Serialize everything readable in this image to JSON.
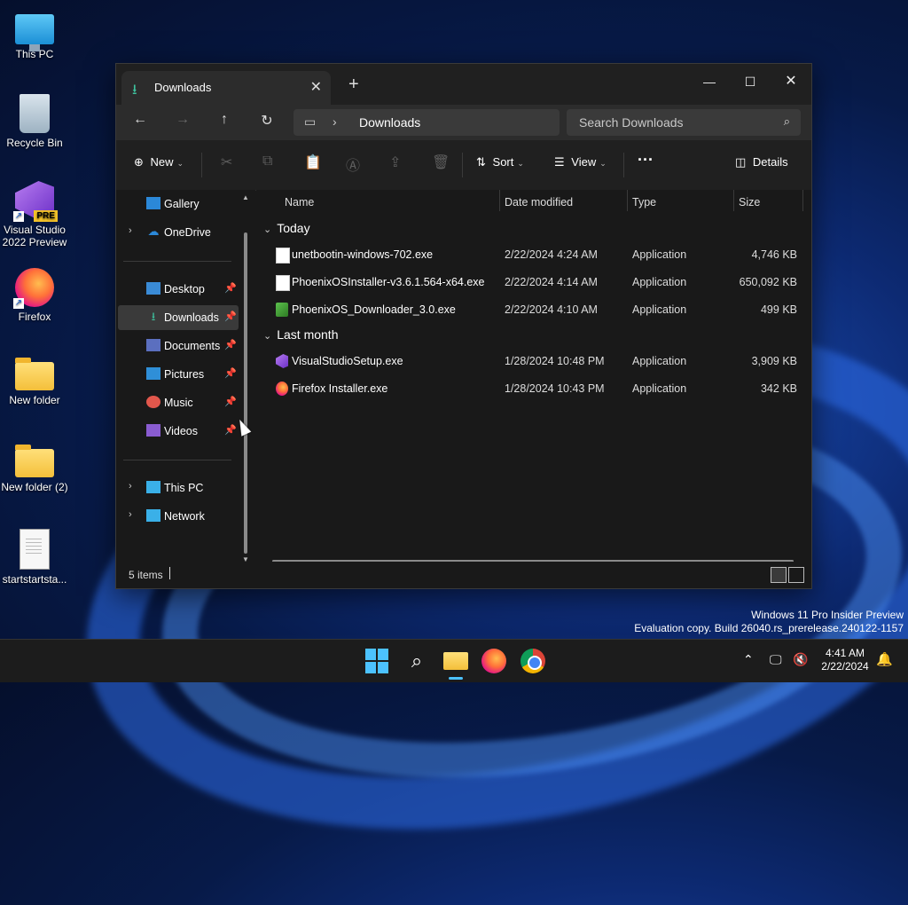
{
  "desktop": {
    "icons": [
      {
        "label": "This PC"
      },
      {
        "label": "Recycle Bin"
      },
      {
        "label": "Visual Studio 2022 Preview",
        "badge": "PRE"
      },
      {
        "label": "Firefox"
      },
      {
        "label": "New folder"
      },
      {
        "label": "New folder (2)"
      },
      {
        "label": "startstartsta..."
      }
    ]
  },
  "window": {
    "tab_title": "Downloads",
    "new_tab": "+",
    "address": {
      "location": "Downloads"
    },
    "search": {
      "placeholder": "Search Downloads"
    },
    "toolbar": {
      "new_label": "New",
      "sort_label": "Sort",
      "view_label": "View",
      "more_label": "···",
      "details_label": "Details"
    },
    "sidebar": {
      "items": [
        {
          "label": "Gallery"
        },
        {
          "label": "OneDrive"
        },
        {
          "label": "Desktop"
        },
        {
          "label": "Downloads"
        },
        {
          "label": "Documents"
        },
        {
          "label": "Pictures"
        },
        {
          "label": "Music"
        },
        {
          "label": "Videos"
        },
        {
          "label": "This PC"
        },
        {
          "label": "Network"
        }
      ]
    },
    "columns": {
      "name": "Name",
      "date": "Date modified",
      "type": "Type",
      "size": "Size"
    },
    "groups": [
      {
        "label": "Today",
        "files": [
          {
            "name": "unetbootin-windows-702.exe",
            "date": "2/22/2024 4:24 AM",
            "type": "Application",
            "size": "4,746 KB"
          },
          {
            "name": "PhoenixOSInstaller-v3.6.1.564-x64.exe",
            "date": "2/22/2024 4:14 AM",
            "type": "Application",
            "size": "650,092 KB"
          },
          {
            "name": "PhoenixOS_Downloader_3.0.exe",
            "date": "2/22/2024 4:10 AM",
            "type": "Application",
            "size": "499 KB"
          }
        ]
      },
      {
        "label": "Last month",
        "files": [
          {
            "name": "VisualStudioSetup.exe",
            "date": "1/28/2024 10:48 PM",
            "type": "Application",
            "size": "3,909 KB"
          },
          {
            "name": "Firefox Installer.exe",
            "date": "1/28/2024 10:43 PM",
            "type": "Application",
            "size": "342 KB"
          }
        ]
      }
    ],
    "status": "5 items"
  },
  "watermark": {
    "line1": "Windows 11 Pro Insider Preview",
    "line2": "Evaluation copy. Build 26040.rs_prerelease.240122-1157"
  },
  "taskbar": {
    "time": "4:41 AM",
    "date": "2/22/2024"
  },
  "colors": {
    "accent": "#4cc2ff",
    "downloads_icon": "#3ec19d"
  }
}
